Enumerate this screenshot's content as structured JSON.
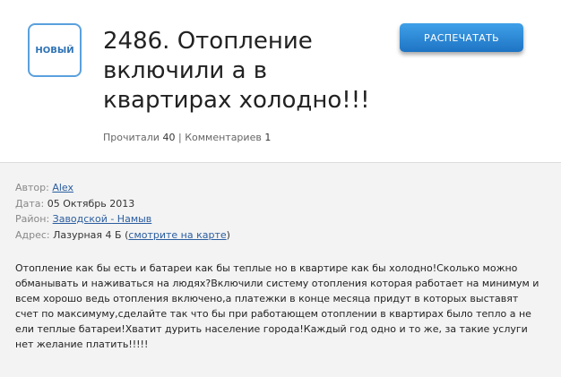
{
  "status_label": "НОВЫЙ",
  "title": "2486. Отопление включили а в квартирах холодно!!!",
  "print_button_label": "РАСПЕЧАТАТЬ",
  "stats": {
    "read_label": "Прочитали",
    "read_count": "40",
    "separator": "|",
    "comments_label": "Комментариев",
    "comments_count": "1"
  },
  "meta": {
    "author_label": "Автор:",
    "author_value": "Alex",
    "date_label": "Дата:",
    "date_value": "05 Октябрь 2013",
    "district_label": "Район:",
    "district_value": "Заводской - Намыв",
    "address_label": "Адрес:",
    "address_value": "Лазурная 4 Б",
    "map_open": "(",
    "map_link": "смотрите на карте",
    "map_close": ")"
  },
  "body_text": "Отопление как бы есть и батареи как бы теплые но в квартире как бы холодно!Сколько можно обманывать и наживаться на людях?Включили систему отопления которая работает на минимум и всем хорошо ведь отопления включено,а платежки в конце месяца придут в которых выставят счет по максимуму,сделайте так что бы при работающем отоплении в квартирах было тепло а не ели теплые батареи!Хватит дурить население города!Каждый год одно и то же, за такие услуги нет желание платить!!!!!"
}
